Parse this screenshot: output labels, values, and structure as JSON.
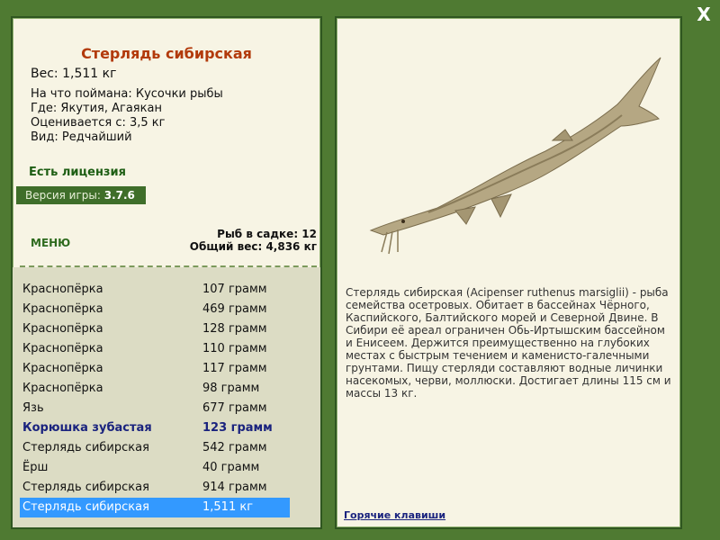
{
  "close_label": "X",
  "fish": {
    "title": "Стерлядь сибирская",
    "weight": "Вес: 1,511 кг",
    "bait": "На что поймана: Кусочки рыбы",
    "location": "Где: Якутия, Агаякан",
    "value": "Оценивается с: 3,5 кг",
    "rarity": "Вид: Редчайший",
    "description": "Стерлядь сибирская (Acipenser ruthenus marsiglii) - рыба семейства осетровых. Обитает в бассейнах Чёрного, Каспийского, Балтийского морей и Северной Двине. В Сибири её ареал ограничен Обь-Иртышским бассейном и Енисеем. Держится преимущественно на глубоких местах с быстрым течением и каменисто-галечными грунтами. Пищу стерляди составляют водные личинки насекомых, черви, моллюски. Достигает длины 115 см и массы 13 кг."
  },
  "license": "Есть лицензия",
  "version_label": "Версия игры:",
  "version_value": "3.7.6",
  "menu_label": "МЕНЮ",
  "stats": {
    "fish_count": "Рыб в садке: 12",
    "total_weight": "Общий вес: 4,836 кг"
  },
  "catch_list": [
    {
      "name": "Краснопёрка",
      "weight": "107 грамм",
      "style": "normal"
    },
    {
      "name": "Краснопёрка",
      "weight": "469 грамм",
      "style": "normal"
    },
    {
      "name": "Краснопёрка",
      "weight": "128 грамм",
      "style": "normal"
    },
    {
      "name": "Краснопёрка",
      "weight": "110 грамм",
      "style": "normal"
    },
    {
      "name": "Краснопёрка",
      "weight": "117 грамм",
      "style": "normal"
    },
    {
      "name": "Краснопёрка",
      "weight": "98 грамм",
      "style": "normal"
    },
    {
      "name": "Язь",
      "weight": "677 грамм",
      "style": "normal"
    },
    {
      "name": "Корюшка зубастая",
      "weight": "123 грамм",
      "style": "bold"
    },
    {
      "name": "Стерлядь сибирская",
      "weight": "542 грамм",
      "style": "normal"
    },
    {
      "name": "Ёрш",
      "weight": "40 грамм",
      "style": "normal"
    },
    {
      "name": "Стерлядь сибирская",
      "weight": "914 грамм",
      "style": "normal"
    },
    {
      "name": "Стерлядь сибирская",
      "weight": "1,511 кг",
      "style": "selected"
    }
  ],
  "hotkeys_label": "Горячие клавиши",
  "colors": {
    "background": "#4f7a32",
    "panel": "#f7f4e4",
    "title": "#b23a0b",
    "selection": "#3399ff",
    "rare_fish": "#1a237e"
  }
}
